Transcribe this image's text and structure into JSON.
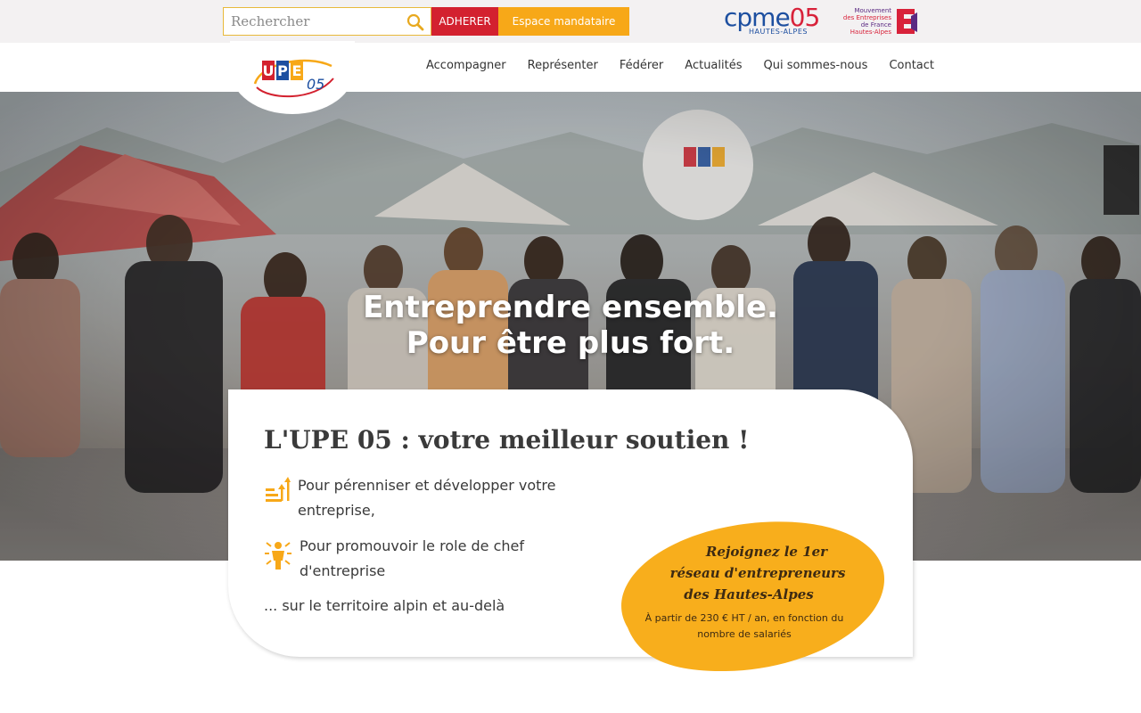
{
  "topbar": {
    "search_placeholder": "Rechercher",
    "adherer_label": "ADHERER",
    "espace_label": "Espace mandataire",
    "cpme": {
      "word_left": "cpme",
      "word_right": "05",
      "sub": "HAUTES-ALPES"
    },
    "medef": {
      "line1": "Mouvement",
      "line2": "des Entreprises",
      "line3": "de France",
      "line4": "Hautes-Alpes"
    }
  },
  "brand": {
    "logo_letters": "UPE",
    "logo_number": "05"
  },
  "nav": {
    "items": [
      "Accompagner",
      "Représenter",
      "Fédérer",
      "Actualités",
      "Qui sommes-nous",
      "Contact"
    ]
  },
  "hero": {
    "title_line1": "Entreprendre ensemble.",
    "title_line2": "Pour être plus fort."
  },
  "card": {
    "title": "L'UPE 05 : votre meilleur soutien !",
    "point1": "Pour pérenniser et développer votre entreprise,",
    "point2": "Pour promouvoir le role de chef d'entreprise",
    "territoire": "... sur le territoire alpin et au-delà"
  },
  "join": {
    "headline_line1": "Rejoignez le 1er",
    "headline_line2": "réseau d'entrepreneurs",
    "headline_line3": "des Hautes-Alpes",
    "price": "À partir de 230 € HT / an, en fonction du nombre de salariés"
  },
  "colors": {
    "accent_red": "#d3212f",
    "accent_orange": "#f7a818",
    "blob_orange": "#f8ae1c",
    "text_dark": "#3a3a3a"
  },
  "icons": {
    "search": "search-icon",
    "growth": "growth-arrows-icon",
    "leader": "leader-icon"
  }
}
